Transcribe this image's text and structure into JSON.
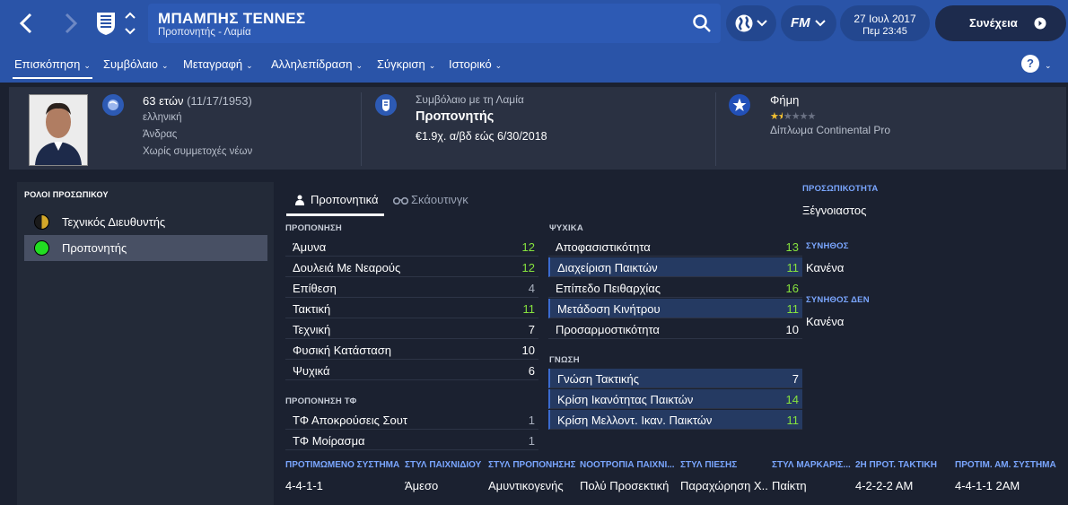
{
  "header": {
    "title": "ΜΠΑΜΠΗΣ ΤΕΝΝΕΣ",
    "subtitle": "Προπονητής - Λαμία",
    "date": "27 Ιουλ 2017",
    "time": "Πεμ 23:45",
    "continue_label": "Συνέχεια",
    "back_icon": "chevron-left-icon",
    "forward_icon": "chevron-right-icon",
    "brand_label": "FM",
    "accent_color": "#2a54a8"
  },
  "tabs": [
    {
      "label": "Επισκόπηση"
    },
    {
      "label": "Συμβόλαιο"
    },
    {
      "label": "Μεταγραφή"
    },
    {
      "label": "Αλληλεπίδραση"
    },
    {
      "label": "Σύγκριση"
    },
    {
      "label": "Ιστορικό"
    }
  ],
  "help_label": "?",
  "info": {
    "age": "63 ετών",
    "dob": "(11/17/1953)",
    "nationality": "ελληνική",
    "gender": "Άνδρας",
    "youth": "Χωρίς συμμετοχές νέων",
    "contract_header": "Συμβόλαιο με τη Λαμία",
    "contract_role": "Προπονητής",
    "contract_terms": "€1.9χ. α/βδ εώς 6/30/2018",
    "fame_header": "Φήμη",
    "fame_stars": "★★★★★",
    "fame_rating": 1.5,
    "license": "Δίπλωμα Continental Pro"
  },
  "roles": {
    "title": "ΡΟΛΟΙ ΠΡΟΣΩΠΙΚΟΥ",
    "items": [
      {
        "label": "Τεχνικός Διευθυντής",
        "color": "#d4a82a"
      },
      {
        "label": "Προπονητής",
        "color": "#22dd22"
      }
    ]
  },
  "subtabs": [
    "Προπονητικά",
    "Σκάουτινγκ"
  ],
  "training": {
    "title": "ΠΡΟΠΟΝΗΣΗ",
    "rows": [
      {
        "name": "Άμυνα",
        "value": "12"
      },
      {
        "name": "Δουλειά Με Νεαρούς",
        "value": "12"
      },
      {
        "name": "Επίθεση",
        "value": "4"
      },
      {
        "name": "Τακτική",
        "value": "11"
      },
      {
        "name": "Τεχνική",
        "value": "7"
      },
      {
        "name": "Φυσική Κατάσταση",
        "value": "10"
      },
      {
        "name": "Ψυχικά",
        "value": "6"
      }
    ]
  },
  "gk": {
    "title": "ΠΡΟΠΟΝΗΣΗ ΤΦ",
    "rows": [
      {
        "name": "ΤΦ Αποκρούσεις Σουτ",
        "value": "1"
      },
      {
        "name": "ΤΦ Μοίρασμα",
        "value": "1"
      }
    ]
  },
  "mental": {
    "title": "ΨΥΧΙΚΑ",
    "rows": [
      {
        "name": "Αποφασιστικότητα",
        "value": "13"
      },
      {
        "name": "Διαχείριση Παικτών",
        "value": "11"
      },
      {
        "name": "Επίπεδο Πειθαρχίας",
        "value": "16"
      },
      {
        "name": "Μετάδοση Κινήτρου",
        "value": "11"
      },
      {
        "name": "Προσαρμοστικότητα",
        "value": "10"
      }
    ]
  },
  "knowledge": {
    "title": "ΓΝΩΣΗ",
    "rows": [
      {
        "name": "Γνώση Τακτικής",
        "value": "7"
      },
      {
        "name": "Κρίση Ικανότητας Παικτών",
        "value": "14"
      },
      {
        "name": "Κρίση Μελλοντ. Ικαν. Παικτών",
        "value": "11"
      }
    ]
  },
  "personality": {
    "title": "ΠΡΟΣΩΠΙΚΟΤΗΤΑ",
    "value": "Ξέγνοιαστος",
    "likes_title": "ΣΥΝΗΘΟΣ",
    "likes_value": "Κανένα",
    "dislikes_title": "ΣΥΝΗΘΟΣ ΔΕΝ",
    "dislikes_value": "Κανένα"
  },
  "prefs": {
    "headers": [
      "ΠΡΟΤΙΜΩΜΕΝΟ ΣΥΣΤΗΜΑ",
      "ΣΤΥΛ ΠΑΙΧΝΙΔΙΟΥ",
      "ΣΤΥΛ ΠΡΟΠΟΝΗΣΗΣ",
      "ΝΟΟΤΡΟΠΙΑ ΠΑΙΧΝΙ...",
      "ΣΤΥΛ ΠΙΕΣΗΣ",
      "ΣΤΥΛ ΜΑΡΚΑΡΙΣ...",
      "2Η ΠΡΟΤ. ΤΑΚΤΙΚΗ",
      "ΠΡΟΤΙΜ. ΑΜ. ΣΥΣΤΗΜΑ"
    ],
    "values": [
      "4-4-1-1",
      "Άμεσο",
      "Αμυντικογενής",
      "Πολύ Προσεκτική",
      "Παραχώρηση Χ...",
      "Παίκτη",
      "4-2-2-2 AM",
      "4-4-1-1 2AM"
    ]
  }
}
